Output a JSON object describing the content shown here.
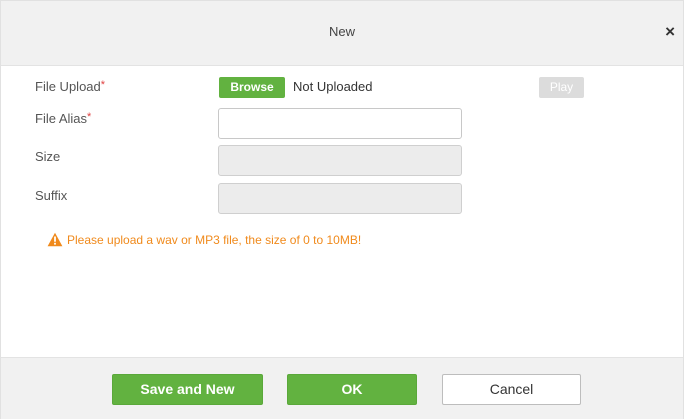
{
  "dialog": {
    "title": "New",
    "close_symbol": "×"
  },
  "form": {
    "file_upload": {
      "label": "File Upload",
      "required_mark": "*",
      "browse_label": "Browse",
      "status": "Not Uploaded",
      "play_label": "Play"
    },
    "file_alias": {
      "label": "File Alias",
      "required_mark": "*",
      "value": ""
    },
    "size": {
      "label": "Size",
      "value": ""
    },
    "suffix": {
      "label": "Suffix",
      "value": ""
    },
    "warning": {
      "icon": "warning-triangle-icon",
      "text": "Please upload a wav or MP3 file, the size of 0 to 10MB!"
    }
  },
  "footer": {
    "save_and_new_label": "Save and New",
    "ok_label": "OK",
    "cancel_label": "Cancel"
  },
  "colors": {
    "accent_green": "#62b240",
    "warning_orange": "#f08a1c",
    "required_red": "#e04040",
    "disabled_gray": "#dcdcdc"
  }
}
